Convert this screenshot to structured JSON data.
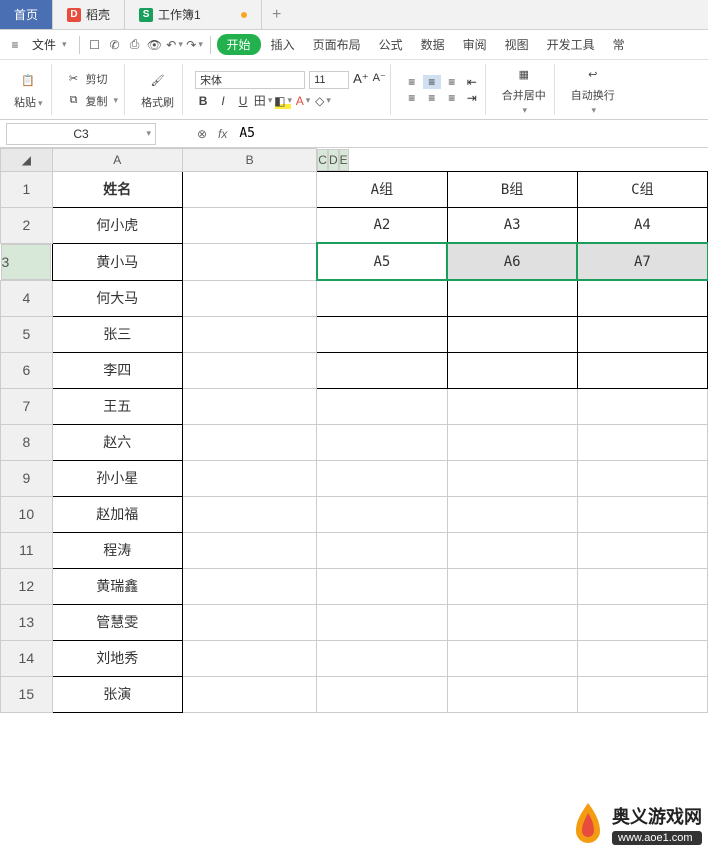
{
  "tabs": {
    "home": "首页",
    "daoke": "稻壳",
    "workbook": "工作簿1"
  },
  "menu": {
    "file": "文件",
    "start": "开始",
    "insert": "插入",
    "pagelayout": "页面布局",
    "formula": "公式",
    "data": "数据",
    "review": "审阅",
    "view": "视图",
    "devtools": "开发工具",
    "more": "常"
  },
  "ribbon": {
    "paste": "粘贴",
    "cut": "剪切",
    "copy": "复制",
    "fmtpaint": "格式刷",
    "font_name": "宋体",
    "font_size": "11",
    "merge": "合并居中",
    "wrap": "自动换行"
  },
  "formula_bar": {
    "name_box": "C3",
    "formula": "A5"
  },
  "columns": [
    "A",
    "B",
    "C",
    "D",
    "E"
  ],
  "rows": [
    "1",
    "2",
    "3",
    "4",
    "5",
    "6",
    "7",
    "8",
    "9",
    "10",
    "11",
    "12",
    "13",
    "14",
    "15"
  ],
  "col_a_header": "姓名",
  "col_a": [
    "何小虎",
    "黄小马",
    "何大马",
    "张三",
    "李四",
    "王五",
    "赵六",
    "孙小星",
    "赵加福",
    "程涛",
    "黄瑞鑫",
    "管慧雯",
    "刘地秀",
    "张演"
  ],
  "groups": {
    "row1": [
      "A组",
      "B组",
      "C组"
    ],
    "row2": [
      "A2",
      "A3",
      "A4"
    ],
    "row3": [
      "A5",
      "A6",
      "A7"
    ]
  },
  "watermark": {
    "title": "奥义游戏网",
    "url": "www.aoe1.com"
  }
}
